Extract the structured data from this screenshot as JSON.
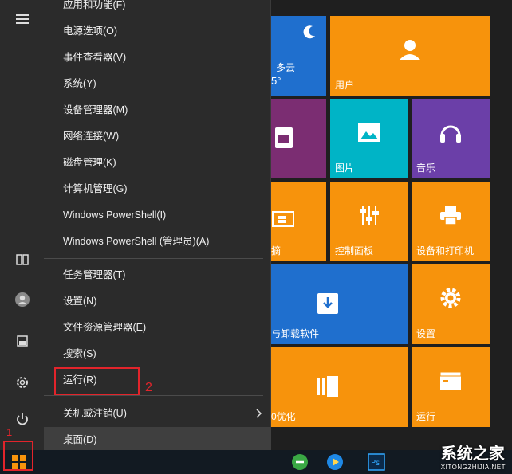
{
  "menu": {
    "items": [
      {
        "label": "应用和功能(F)"
      },
      {
        "label": "电源选项(O)"
      },
      {
        "label": "事件查看器(V)"
      },
      {
        "label": "系统(Y)"
      },
      {
        "label": "设备管理器(M)"
      },
      {
        "label": "网络连接(W)"
      },
      {
        "label": "磁盘管理(K)"
      },
      {
        "label": "计算机管理(G)"
      },
      {
        "label": "Windows PowerShell(I)"
      },
      {
        "label": "Windows PowerShell (管理员)(A)"
      },
      {
        "label": "任务管理器(T)"
      },
      {
        "label": "设置(N)"
      },
      {
        "label": "文件资源管理器(E)"
      },
      {
        "label": "搜索(S)"
      },
      {
        "label": "运行(R)"
      },
      {
        "label": "关机或注销(U)"
      },
      {
        "label": "桌面(D)"
      }
    ]
  },
  "tiles": {
    "weather_label": "多云",
    "weather_temp": "5°",
    "user": "用户",
    "photos": "图片",
    "music": "音乐",
    "cut_left_1": "摘",
    "control_panel": "控制面板",
    "devices_printers": "设备和打印机",
    "cut_left_2": "与卸载软件",
    "settings": "设置",
    "cut_left_3": "0优化",
    "run": "运行"
  },
  "annotations": {
    "start_marker": "1",
    "run_marker": "2"
  },
  "watermark": {
    "brand": "系统之家",
    "url": "XITONGZHIJIA.NET"
  },
  "colors": {
    "orange": "#f7930c",
    "cyan": "#00b4c6",
    "purple": "#6b3fa8",
    "magenta": "#7b2d72",
    "blue": "#1f6fce",
    "highlight_red": "#e2242b"
  }
}
